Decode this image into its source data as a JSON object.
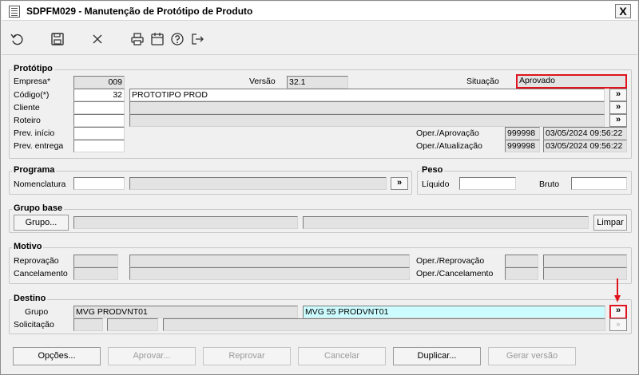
{
  "title": "SDPFM029 - Manutenção de Protótipo de Produto",
  "close_label": "X",
  "toolbar": {
    "icons": [
      "undo-icon",
      "save-icon",
      "delete-icon",
      "print-icon",
      "calendar-icon",
      "help-icon",
      "exit-icon"
    ]
  },
  "prototipo": {
    "title": "Protótipo",
    "empresa_label": "Empresa*",
    "empresa_value": "009",
    "versao_label": "Versão",
    "versao_value": "32.1",
    "situacao_label": "Situação",
    "situacao_value": "Aprovado",
    "codigo_label": "Código(*)",
    "codigo_value": "32",
    "codigo_desc": "PROTOTIPO PROD",
    "cliente_label": "Cliente",
    "roteiro_label": "Roteiro",
    "prev_inicio_label": "Prev. início",
    "prev_entrega_label": "Prev. entrega",
    "oper_aprovacao_label": "Oper./Aprovação",
    "oper_aprovacao_user": "999998",
    "oper_aprovacao_date": "03/05/2024 09:56:22",
    "oper_atualizacao_label": "Oper./Atualização",
    "oper_atualizacao_user": "999998",
    "oper_atualizacao_date": "03/05/2024 09:56:22"
  },
  "programa": {
    "title": "Programa",
    "nomenclatura_label": "Nomenclatura"
  },
  "peso": {
    "title": "Peso",
    "liquido_label": "Líquido",
    "bruto_label": "Bruto"
  },
  "grupo_base": {
    "title": "Grupo base",
    "grupo_button": "Grupo...",
    "limpar_button": "Limpar"
  },
  "motivo": {
    "title": "Motivo",
    "reprovacao_label": "Reprovação",
    "cancelamento_label": "Cancelamento",
    "oper_reprovacao_label": "Oper./Reprovação",
    "oper_cancelamento_label": "Oper./Cancelamento"
  },
  "destino": {
    "title": "Destino",
    "grupo_label": "Grupo",
    "grupo_value": "MVG PRODVNT01",
    "grupo_value2": "MVG 55 PRODVNT01",
    "solicitacao_label": "Solicitação"
  },
  "search_glyph": "»",
  "bottom_buttons": {
    "opcoes": "Opções...",
    "aprovar": "Aprovar...",
    "reprovar": "Reprovar",
    "cancelar": "Cancelar",
    "duplicar": "Duplicar...",
    "gerar_versao": "Gerar versão"
  },
  "colors": {
    "highlight_border": "#e0141e",
    "cyan_field": "#ccfcff"
  }
}
